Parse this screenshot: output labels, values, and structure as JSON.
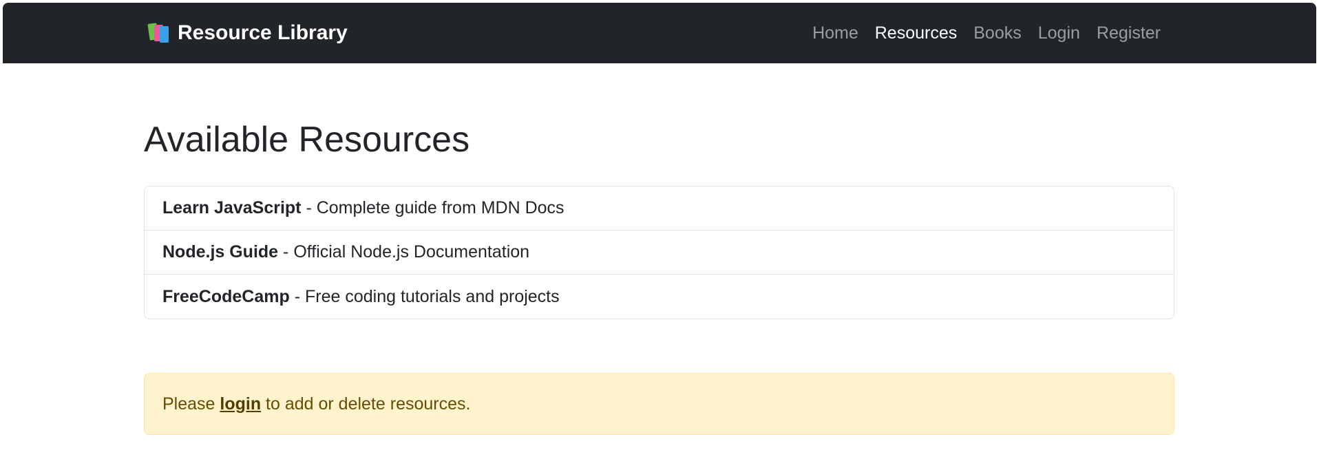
{
  "navbar": {
    "brand_icon": "books-icon",
    "brand_text": "Resource Library",
    "links": [
      {
        "label": "Home",
        "active": false
      },
      {
        "label": "Resources",
        "active": true
      },
      {
        "label": "Books",
        "active": false
      },
      {
        "label": "Login",
        "active": false
      },
      {
        "label": "Register",
        "active": false
      }
    ],
    "colors": {
      "background": "#212529",
      "active_link": "#ffffff",
      "inactive_link": "rgba(255,255,255,0.55)"
    }
  },
  "main": {
    "title": "Available Resources",
    "resources": [
      {
        "name": "Learn JavaScript",
        "separator": " - ",
        "description": "Complete guide from MDN Docs"
      },
      {
        "name": "Node.js Guide",
        "separator": " - ",
        "description": "Official Node.js Documentation"
      },
      {
        "name": "FreeCodeCamp",
        "separator": " - ",
        "description": "Free coding tutorials and projects"
      }
    ]
  },
  "alert": {
    "prefix": "Please ",
    "link_text": "login",
    "suffix": " to add or delete resources.",
    "colors": {
      "background": "#fff3cd",
      "border": "#ffe69c",
      "text": "#664d03"
    }
  }
}
